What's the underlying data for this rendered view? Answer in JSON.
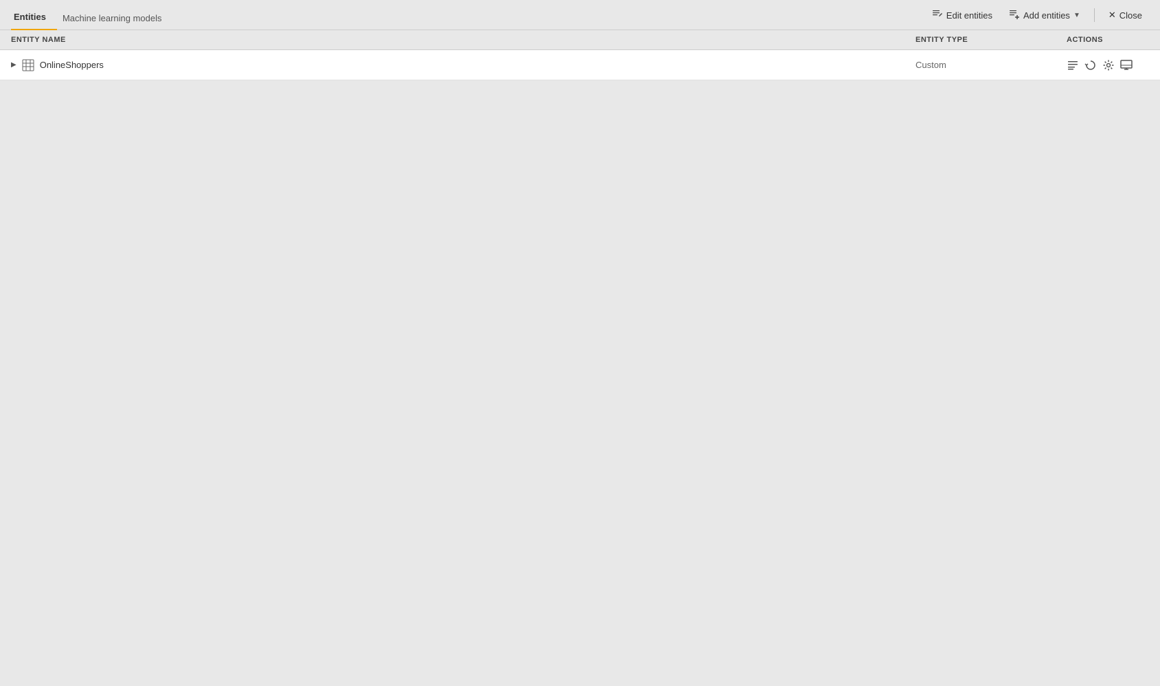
{
  "tabs": [
    {
      "id": "entities",
      "label": "Entities",
      "active": true
    },
    {
      "id": "ml-models",
      "label": "Machine learning models",
      "active": false
    }
  ],
  "toolbar": {
    "edit_entities_label": "Edit entities",
    "add_entities_label": "Add entities",
    "close_label": "Close"
  },
  "table": {
    "columns": {
      "entity_name": "ENTITY NAME",
      "entity_type": "ENTITY TYPE",
      "actions": "ACTIONS"
    },
    "rows": [
      {
        "name": "OnlineShoppers",
        "type": "Custom",
        "expanded": false
      }
    ]
  },
  "icons": {
    "edit": "edit-icon",
    "add": "add-icon",
    "close": "close-icon",
    "expand": "expand-icon",
    "table": "table-icon",
    "action_edit": "action-edit-icon",
    "action_refresh": "action-refresh-icon",
    "action_settings": "action-settings-icon",
    "action_monitor": "action-monitor-icon"
  }
}
